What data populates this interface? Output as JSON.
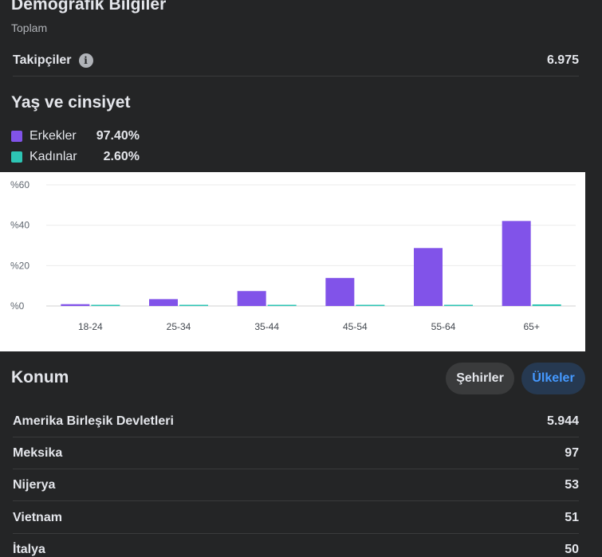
{
  "header": {
    "title": "Demografik Bilgiler",
    "subtitle": "Toplam"
  },
  "followers": {
    "label": "Takipçiler",
    "value": "6.975",
    "info_icon": "info-icon"
  },
  "age_gender": {
    "title": "Yaş ve cinsiyet",
    "legend": [
      {
        "label": "Erkekler",
        "value": "97.40%",
        "color": "#8153e9"
      },
      {
        "label": "Kadınlar",
        "value": "2.60%",
        "color": "#2dc5b4"
      }
    ]
  },
  "chart_data": {
    "type": "bar",
    "categories": [
      "18-24",
      "25-34",
      "35-44",
      "45-54",
      "55-64",
      "65+"
    ],
    "series": [
      {
        "name": "Erkekler",
        "color": "#8153e9",
        "values": [
          0.9,
          3.4,
          7.4,
          13.9,
          28.7,
          42.1
        ]
      },
      {
        "name": "Kadınlar",
        "color": "#2dc5b4",
        "values": [
          0.2,
          0.2,
          0.3,
          0.4,
          0.5,
          0.8
        ]
      }
    ],
    "y_ticks": [
      "%0",
      "%20",
      "%40",
      "%60"
    ],
    "ylim": [
      0,
      60
    ],
    "grid": true
  },
  "location": {
    "title": "Konum",
    "buttons": {
      "cities": "Şehirler",
      "countries": "Ülkeler"
    },
    "rows": [
      {
        "name": "Amerika Birleşik Devletleri",
        "value": "5.944"
      },
      {
        "name": "Meksika",
        "value": "97"
      },
      {
        "name": "Nijerya",
        "value": "53"
      },
      {
        "name": "Vietnam",
        "value": "51"
      },
      {
        "name": "İtalya",
        "value": "50"
      }
    ]
  },
  "colors": {
    "background": "#242526",
    "active_button_bg": "#263951",
    "active_button_text": "#4599ff",
    "inactive_button_bg": "#3a3b3c"
  }
}
